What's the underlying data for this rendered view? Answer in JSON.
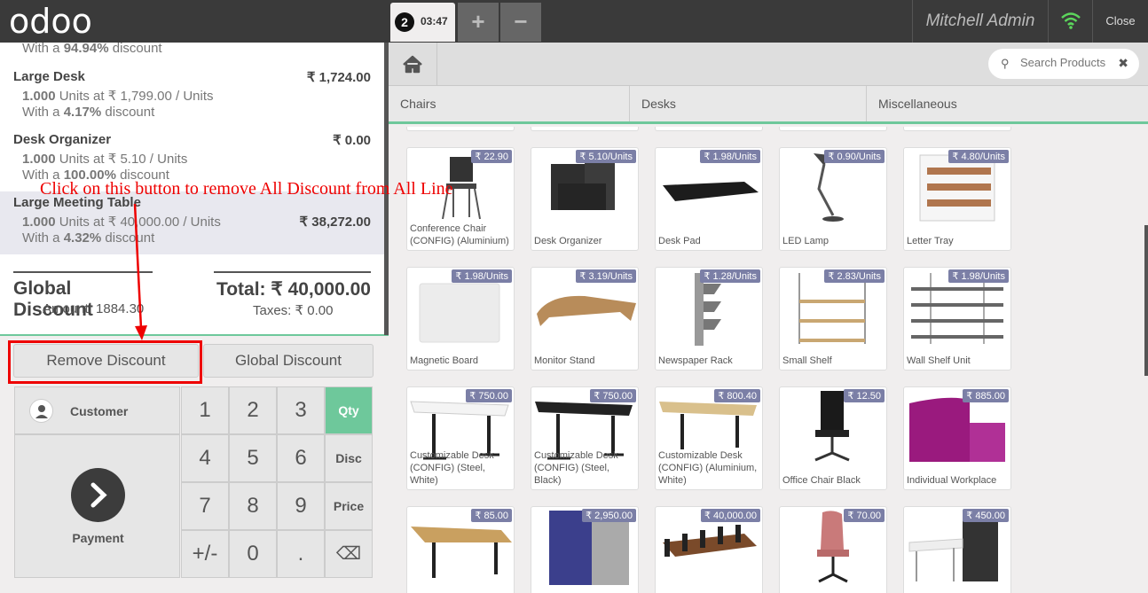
{
  "topbar": {
    "logo": "odoo",
    "order_number": "2",
    "order_time": "03:47",
    "add_label": "+",
    "remove_label": "−",
    "user": "Mitchell Admin",
    "close_label": "Close"
  },
  "order": {
    "previous_discount_prefix": "With a ",
    "previous_discount_value": "94.94%",
    "previous_discount_suffix": " discount",
    "lines": [
      {
        "name": "Large Desk",
        "price": "₹ 1,724.00",
        "qty": "1.000",
        "unit_info": " Units at ₹ 1,799.00 / Units",
        "discount": "4.17%"
      },
      {
        "name": "Desk Organizer",
        "price": "₹ 0.00",
        "qty": "1.000",
        "unit_info": " Units at ₹ 5.10 / Units",
        "discount": "100.00%"
      },
      {
        "name": "Large Meeting Table",
        "price": "₹ 38,272.00",
        "qty": "1.000",
        "unit_info": " Units at ₹ 40,000.00 / Units",
        "discount": "4.32%"
      }
    ],
    "discount_prefix": "With a ",
    "discount_suffix": " discount",
    "global_discount_title": "Global Discount",
    "global_discount_amount": "Amount: 1884.30",
    "total": "Total: ₹ 40,000.00",
    "taxes": "Taxes: ₹ 0.00"
  },
  "controls": {
    "remove_discount": "Remove Discount",
    "global_discount": "Global Discount",
    "customer": "Customer",
    "payment": "Payment",
    "keys": [
      "1",
      "2",
      "3",
      "4",
      "5",
      "6",
      "7",
      "8",
      "9",
      "+/-",
      "0",
      "."
    ],
    "modes": [
      "Qty",
      "Disc",
      "Price"
    ],
    "backspace": "⌫"
  },
  "search": {
    "placeholder": "Search Products",
    "clear": "✖"
  },
  "categories": [
    "Chairs",
    "Desks",
    "Miscellaneous"
  ],
  "products": [
    {
      "name": "Conference Chair (CONFIG) (Aluminium)",
      "price": "₹ 22.90"
    },
    {
      "name": "Desk Organizer",
      "price": "₹ 5.10/Units"
    },
    {
      "name": "Desk Pad",
      "price": "₹ 1.98/Units"
    },
    {
      "name": "LED Lamp",
      "price": "₹ 0.90/Units"
    },
    {
      "name": "Letter Tray",
      "price": "₹ 4.80/Units"
    },
    {
      "name": "Magnetic Board",
      "price": "₹ 1.98/Units"
    },
    {
      "name": "Monitor Stand",
      "price": "₹ 3.19/Units"
    },
    {
      "name": "Newspaper Rack",
      "price": "₹ 1.28/Units"
    },
    {
      "name": "Small Shelf",
      "price": "₹ 2.83/Units"
    },
    {
      "name": "Wall Shelf Unit",
      "price": "₹ 1.98/Units"
    },
    {
      "name": "Customizable Desk (CONFIG) (Steel, White)",
      "price": "₹ 750.00"
    },
    {
      "name": "Customizable Desk (CONFIG) (Steel, Black)",
      "price": "₹ 750.00"
    },
    {
      "name": "Customizable Desk (CONFIG) (Aluminium, White)",
      "price": "₹ 800.40"
    },
    {
      "name": "Office Chair Black",
      "price": "₹ 12.50"
    },
    {
      "name": "Individual Workplace",
      "price": "₹ 885.00"
    },
    {
      "name": "",
      "price": "₹ 85.00"
    },
    {
      "name": "",
      "price": "₹ 2,950.00"
    },
    {
      "name": "",
      "price": "₹ 40,000.00"
    },
    {
      "name": "",
      "price": "₹ 70.00"
    },
    {
      "name": "",
      "price": "₹ 450.00"
    }
  ],
  "annotation": {
    "text": "Click on this button to remove All Discount from All Line"
  },
  "colors": {
    "accent_green": "#6ec89b",
    "price_tag": "#7b7fa6",
    "annotation": "#ee0000",
    "topbar": "#3a3a3a"
  }
}
